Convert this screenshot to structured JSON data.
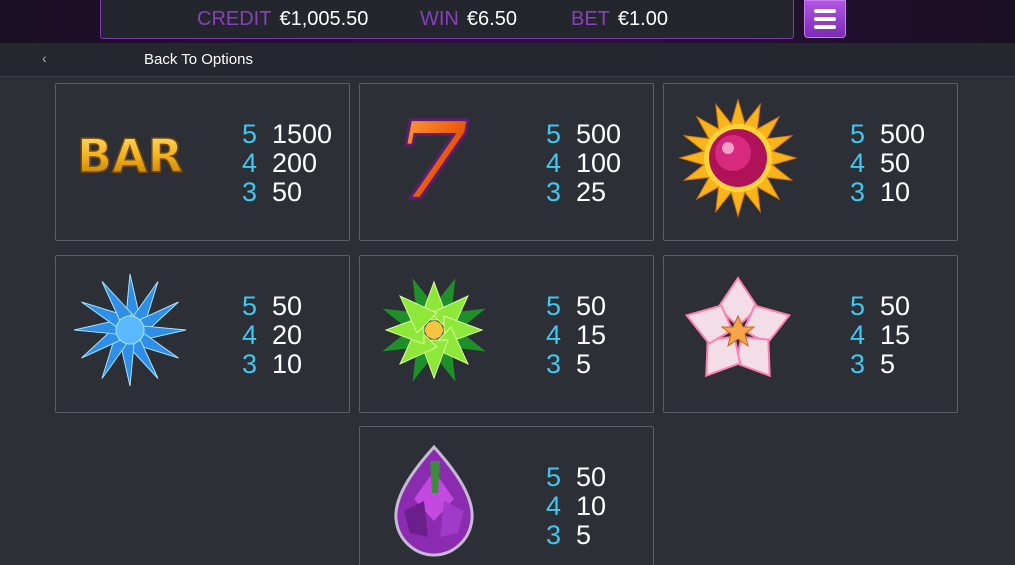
{
  "header": {
    "credit_label": "CREDIT",
    "credit_value": "€1,005.50",
    "win_label": "WIN",
    "win_value": "€6.50",
    "bet_label": "BET",
    "bet_value": "€1.00"
  },
  "nav": {
    "back_label": "Back To Options",
    "back_chevron": "‹"
  },
  "colors": {
    "accent": "#8a3fbd",
    "count": "#3fc7f0",
    "menu": "#9b45d4"
  },
  "paytable": [
    {
      "symbol": "bar-icon",
      "symbol_text": "BAR",
      "pays": [
        {
          "count": "5",
          "amount": "1500"
        },
        {
          "count": "4",
          "amount": "200"
        },
        {
          "count": "3",
          "amount": "50"
        }
      ]
    },
    {
      "symbol": "seven-icon",
      "symbol_text": "7",
      "pays": [
        {
          "count": "5",
          "amount": "500"
        },
        {
          "count": "4",
          "amount": "100"
        },
        {
          "count": "3",
          "amount": "25"
        }
      ]
    },
    {
      "symbol": "sunflower-gem-icon",
      "pays": [
        {
          "count": "5",
          "amount": "500"
        },
        {
          "count": "4",
          "amount": "50"
        },
        {
          "count": "3",
          "amount": "10"
        }
      ]
    },
    {
      "symbol": "blue-crystal-flower-icon",
      "pays": [
        {
          "count": "5",
          "amount": "50"
        },
        {
          "count": "4",
          "amount": "20"
        },
        {
          "count": "3",
          "amount": "10"
        }
      ]
    },
    {
      "symbol": "green-crystal-flower-icon",
      "pays": [
        {
          "count": "5",
          "amount": "50"
        },
        {
          "count": "4",
          "amount": "15"
        },
        {
          "count": "3",
          "amount": "5"
        }
      ]
    },
    {
      "symbol": "pink-crystal-flower-icon",
      "pays": [
        {
          "count": "5",
          "amount": "50"
        },
        {
          "count": "4",
          "amount": "15"
        },
        {
          "count": "3",
          "amount": "5"
        }
      ]
    },
    {
      "symbol": "purple-crystal-bud-icon",
      "pays": [
        {
          "count": "5",
          "amount": "50"
        },
        {
          "count": "4",
          "amount": "10"
        },
        {
          "count": "3",
          "amount": "5"
        }
      ]
    }
  ]
}
